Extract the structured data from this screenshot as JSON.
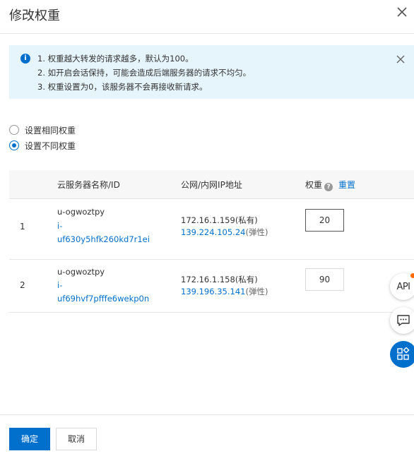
{
  "dialog": {
    "title": "修改权重"
  },
  "notice": {
    "lines": [
      "1. 权重越大转发的请求越多，默认为100。",
      "2. 如开启会话保持，可能会造成后端服务器的请求不均匀。",
      "3. 权重设置为0，该服务器不会再接收新请求。"
    ]
  },
  "weight_mode": {
    "options": [
      {
        "label": "设置相同权重",
        "checked": false
      },
      {
        "label": "设置不同权重",
        "checked": true
      }
    ]
  },
  "table": {
    "headers": {
      "name": "云服务器名称/ID",
      "ip": "公网/内网IP地址",
      "weight": "权重",
      "reset": "重置"
    },
    "rows": [
      {
        "index": "1",
        "name": "u-ogwoztpy",
        "id_line1": "i-",
        "id_line2": "uf630y5hfk260kd7r1ei",
        "private_ip": "172.16.1.159(私有)",
        "public_ip": "139.224.105.24",
        "public_suffix": "(弹性)",
        "weight": "20"
      },
      {
        "index": "2",
        "name": "u-ogwoztpy",
        "id_line1": "i-",
        "id_line2": "uf69hvf7pfffe6wekp0n",
        "private_ip": "172.16.1.158(私有)",
        "public_ip": "139.196.35.141",
        "public_suffix": "(弹性)",
        "weight": "90"
      }
    ]
  },
  "floating": {
    "api_label": "API"
  },
  "footer": {
    "confirm": "确定",
    "cancel": "取消"
  },
  "colors": {
    "primary": "#0070cc",
    "notice_bg": "#e6f4fc",
    "badge": "#ff6a00"
  }
}
